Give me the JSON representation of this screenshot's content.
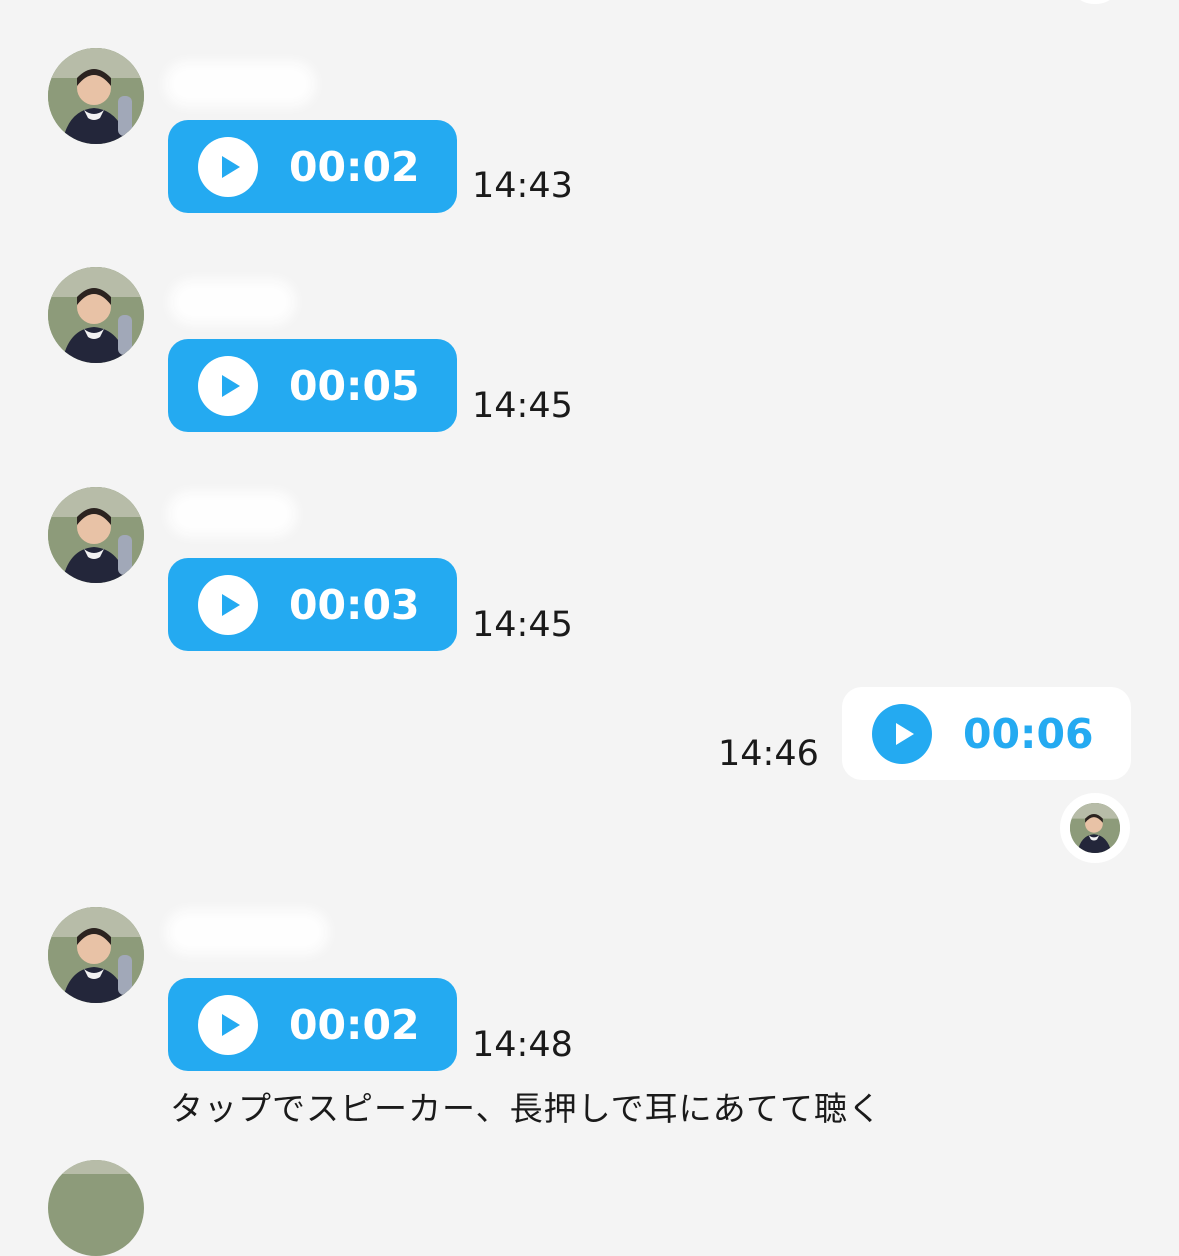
{
  "colors": {
    "background": "#f4f4f4",
    "incoming_bubble": "#24aaf1",
    "outgoing_bubble": "#ffffff",
    "text": "#1a1a1a"
  },
  "messages": [
    {
      "direction": "incoming",
      "duration": "00:02",
      "time": "14:43",
      "icon": "play-icon"
    },
    {
      "direction": "incoming",
      "duration": "00:05",
      "time": "14:45",
      "icon": "play-icon"
    },
    {
      "direction": "incoming",
      "duration": "00:03",
      "time": "14:45",
      "icon": "play-icon"
    },
    {
      "direction": "outgoing",
      "duration": "00:06",
      "time": "14:46",
      "icon": "play-icon"
    },
    {
      "direction": "incoming",
      "duration": "00:02",
      "time": "14:48",
      "icon": "play-icon"
    }
  ],
  "hint_text": "タップでスピーカー、長押しで耳にあてて聴く"
}
